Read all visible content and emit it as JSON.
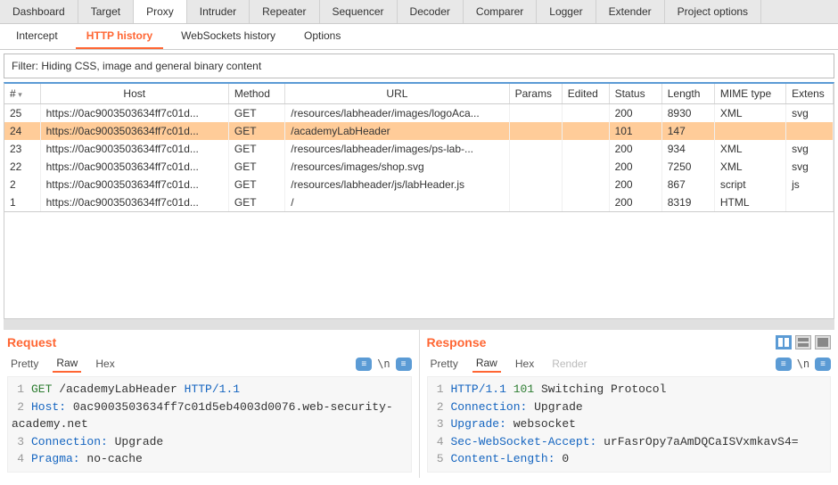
{
  "mainTabs": [
    "Dashboard",
    "Target",
    "Proxy",
    "Intruder",
    "Repeater",
    "Sequencer",
    "Decoder",
    "Comparer",
    "Logger",
    "Extender",
    "Project options"
  ],
  "mainActive": "Proxy",
  "subTabs": [
    "Intercept",
    "HTTP history",
    "WebSockets history",
    "Options"
  ],
  "subActive": "HTTP history",
  "filterText": "Filter: Hiding CSS, image and general binary content",
  "columns": [
    "#",
    "Host",
    "Method",
    "URL",
    "Params",
    "Edited",
    "Status",
    "Length",
    "MIME type",
    "Extens"
  ],
  "rows": [
    {
      "n": "25",
      "host": "https://0ac9003503634ff7c01d...",
      "method": "GET",
      "url": "/resources/labheader/images/logoAca...",
      "params": "",
      "edited": "",
      "status": "200",
      "length": "8930",
      "mime": "XML",
      "ext": "svg",
      "sel": false
    },
    {
      "n": "24",
      "host": "https://0ac9003503634ff7c01d...",
      "method": "GET",
      "url": "/academyLabHeader",
      "params": "",
      "edited": "",
      "status": "101",
      "length": "147",
      "mime": "",
      "ext": "",
      "sel": true
    },
    {
      "n": "23",
      "host": "https://0ac9003503634ff7c01d...",
      "method": "GET",
      "url": "/resources/labheader/images/ps-lab-...",
      "params": "",
      "edited": "",
      "status": "200",
      "length": "934",
      "mime": "XML",
      "ext": "svg",
      "sel": false
    },
    {
      "n": "22",
      "host": "https://0ac9003503634ff7c01d...",
      "method": "GET",
      "url": "/resources/images/shop.svg",
      "params": "",
      "edited": "",
      "status": "200",
      "length": "7250",
      "mime": "XML",
      "ext": "svg",
      "sel": false
    },
    {
      "n": "2",
      "host": "https://0ac9003503634ff7c01d...",
      "method": "GET",
      "url": "/resources/labheader/js/labHeader.js",
      "params": "",
      "edited": "",
      "status": "200",
      "length": "867",
      "mime": "script",
      "ext": "js",
      "sel": false
    },
    {
      "n": "1",
      "host": "https://0ac9003503634ff7c01d...",
      "method": "GET",
      "url": "/",
      "params": "",
      "edited": "",
      "status": "200",
      "length": "8319",
      "mime": "HTML",
      "ext": "",
      "sel": false
    }
  ],
  "request": {
    "title": "Request",
    "tabs": [
      "Pretty",
      "Raw",
      "Hex"
    ],
    "active": "Raw",
    "tool": "≡",
    "wrap": "\\n",
    "lines": [
      {
        "n": "1",
        "html": "<span class='hl-m'>GET</span> <span class='hl-p'>/academyLabHeader</span> <span class='hl-k'>HTTP/1.1</span>"
      },
      {
        "n": "2",
        "html": "<span class='hl-k'>Host:</span> 0ac9003503634ff7c01d5eb4003d0076.web-security-academy.net"
      },
      {
        "n": "3",
        "html": "<span class='hl-k'>Connection:</span> Upgrade"
      },
      {
        "n": "4",
        "html": "<span class='hl-k'>Pragma:</span> no-cache"
      }
    ]
  },
  "response": {
    "title": "Response",
    "tabs": [
      "Pretty",
      "Raw",
      "Hex",
      "Render"
    ],
    "active": "Raw",
    "tool": "≡",
    "wrap": "\\n",
    "lines": [
      {
        "n": "1",
        "html": "<span class='hl-k'>HTTP/1.1</span> <span class='hl-m'>101</span> <span class='hl-p'>Switching Protocol</span>"
      },
      {
        "n": "2",
        "html": "<span class='hl-k'>Connection:</span> Upgrade"
      },
      {
        "n": "3",
        "html": "<span class='hl-k'>Upgrade:</span> websocket"
      },
      {
        "n": "4",
        "html": "<span class='hl-k'>Sec-WebSocket-Accept:</span> urFasrOpy7aAmDQCaISVxmkavS4="
      },
      {
        "n": "5",
        "html": "<span class='hl-k'>Content-Length:</span> 0"
      }
    ]
  }
}
